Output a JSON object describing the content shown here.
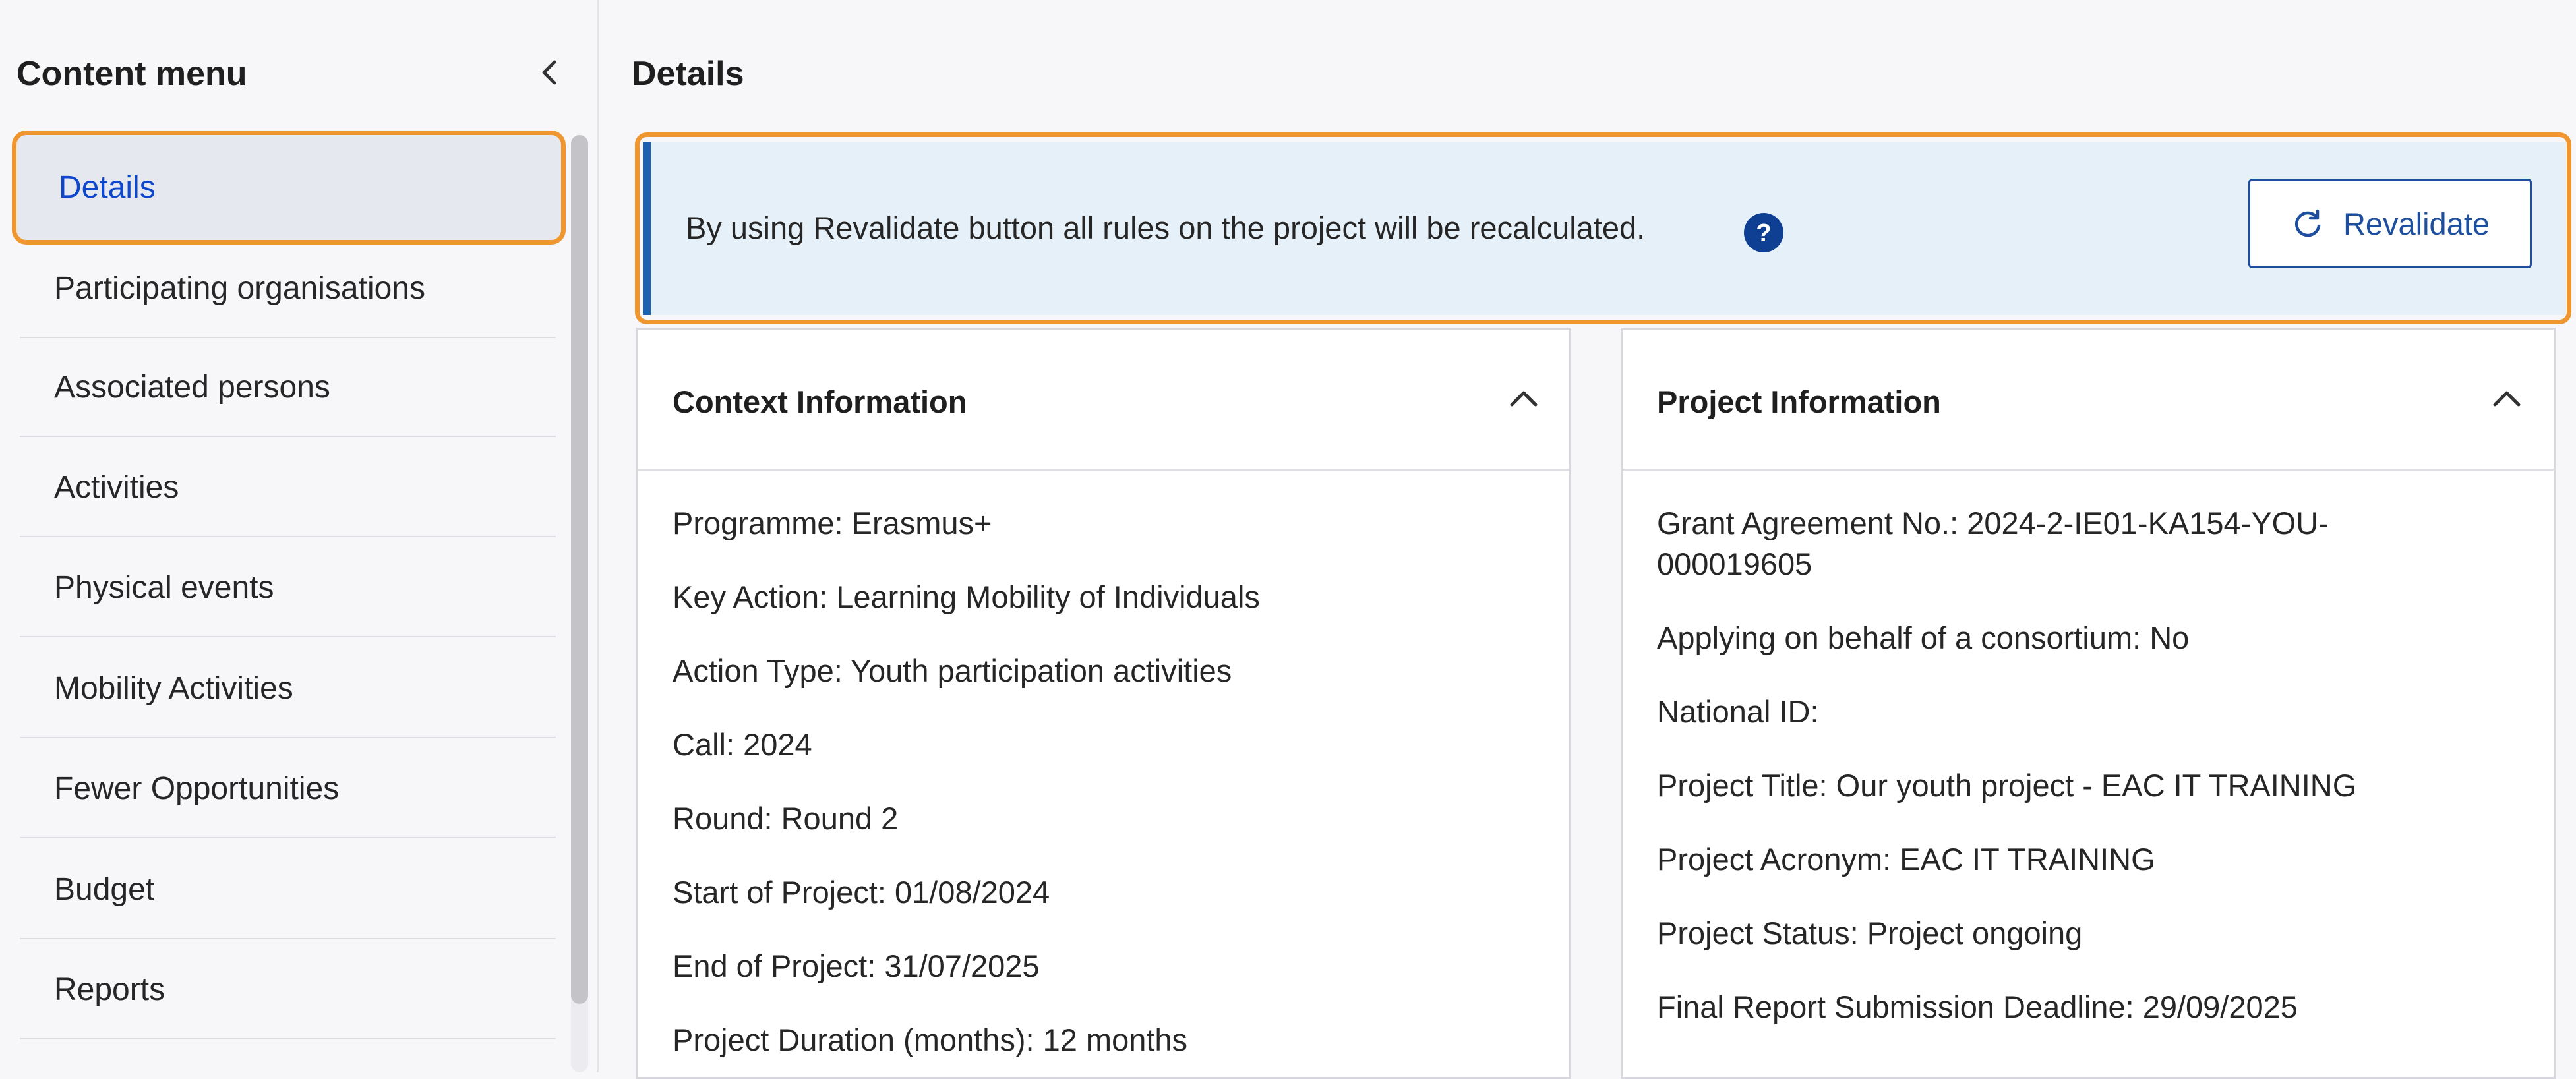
{
  "sidebar": {
    "title": "Content menu",
    "items": [
      {
        "label": "Details",
        "active": true
      },
      {
        "label": "Participating organisations"
      },
      {
        "label": "Associated persons"
      },
      {
        "label": "Activities"
      },
      {
        "label": "Physical events"
      },
      {
        "label": "Mobility Activities"
      },
      {
        "label": "Fewer Opportunities"
      },
      {
        "label": "Budget"
      },
      {
        "label": "Reports"
      }
    ]
  },
  "main": {
    "title": "Details",
    "banner": {
      "text": "By using Revalidate button all rules on the project will be recalculated.",
      "button_label": "Revalidate"
    },
    "context": {
      "title": "Context Information",
      "fields": [
        "Programme: Erasmus+",
        "Key Action: Learning Mobility of Individuals",
        "Action Type: Youth participation activities",
        "Call: 2024",
        "Round: Round 2",
        "Start of Project: 01/08/2024",
        "End of Project: 31/07/2025",
        "Project Duration (months): 12 months"
      ]
    },
    "project": {
      "title": "Project Information",
      "grant_line1": "Grant Agreement No.: 2024-2-IE01-KA154-YOU-",
      "grant_line2": "000019605",
      "fields": [
        "Applying on behalf of a consortium: No",
        "National ID:",
        "Project Title: Our youth project - EAC IT TRAINING",
        "Project Acronym: EAC IT TRAINING",
        "Project Status: Project ongoing",
        "Final Report Submission Deadline: 29/09/2025"
      ]
    }
  },
  "colors": {
    "accent_outline": "#f0962f",
    "primary_blue": "#1d4f9e",
    "banner_bg": "#e5f0f8",
    "active_item_bg": "#e6e8f0"
  }
}
